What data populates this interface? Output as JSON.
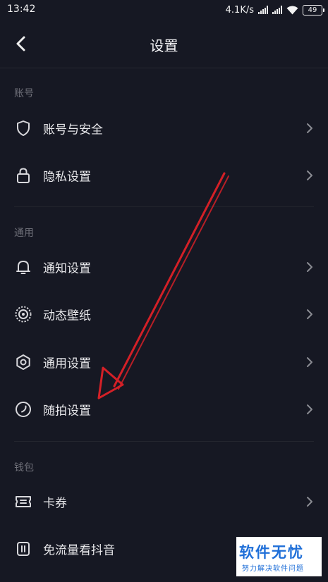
{
  "status_bar": {
    "time": "13:42",
    "speed": "4.1K/s",
    "battery": "49"
  },
  "header": {
    "title": "设置"
  },
  "sections": [
    {
      "label": "账号",
      "items": [
        {
          "label": "账号与安全",
          "icon": "shield-icon"
        },
        {
          "label": "隐私设置",
          "icon": "lock-icon"
        }
      ]
    },
    {
      "label": "通用",
      "items": [
        {
          "label": "通知设置",
          "icon": "bell-icon"
        },
        {
          "label": "动态壁纸",
          "icon": "wallpaper-icon"
        },
        {
          "label": "通用设置",
          "icon": "gear-icon"
        },
        {
          "label": "随拍设置",
          "icon": "capture-icon"
        }
      ]
    },
    {
      "label": "钱包",
      "items": [
        {
          "label": "卡券",
          "icon": "ticket-icon"
        },
        {
          "label": "免流量看抖音",
          "icon": "data-card-icon"
        }
      ]
    }
  ],
  "watermark": {
    "title": "软件无忧",
    "subtitle": "努力解决软件问题"
  },
  "colors": {
    "background": "#161823",
    "annotation": "#d42027",
    "watermark_text": "#1f6fd8"
  }
}
